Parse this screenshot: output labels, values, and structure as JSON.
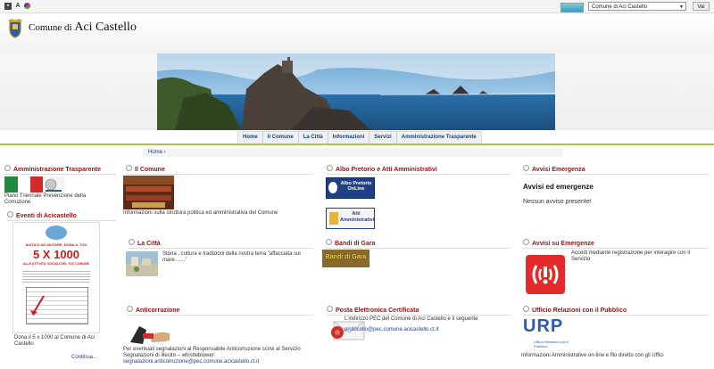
{
  "toolbar": {
    "select_value": "Comune di Aci Castello",
    "go_label": "Vai",
    "font_glyph": "A"
  },
  "site": {
    "prefix": "Comune di",
    "name": "Aci Castello"
  },
  "nav": {
    "items": [
      "Home",
      "Il Comune",
      "La Città",
      "Informazioni",
      "Servizi",
      "Amministrazione Trasparente"
    ]
  },
  "breadcrumb": "Home",
  "sections": {
    "amministrazione": {
      "title": "Amministrazione Trasparente",
      "text": "Piano Triennale Prevenzione della Corruzione"
    },
    "eventi": {
      "title": "Eventi di Acicastello",
      "poster_heading": "AIUTACI AD AIUTARE, DONA IL TUO",
      "poster_big": "5 X 1000",
      "poster_sub": "ALLE ATTIVITA' SOCIALI DEL TUO COMUNE",
      "text": "Dona il 5 x 1000 al Comune di Aci Castello",
      "more": "Continua..."
    },
    "comune": {
      "title": "Il Comune",
      "text": "Informazioni sulla struttura politica ed amministrativa del Comune"
    },
    "citta": {
      "title": "La Città",
      "text": "Storia , cultura e tradizioni della nostra terra \"affacciata sul mare.......\""
    },
    "anticorruzione": {
      "title": "Anticorruzione",
      "text": "Per eventuali segnalazioni al Responsabile Anticorruzione scrivi al Servizio Segnalazioni di illecito – whistleblower:",
      "email": "segnalazioni.anticorruzione@pec.comune.acicastello.ct.it"
    },
    "albo": {
      "title": "Albo Pretorio e Atti Amministrativi",
      "albo_label": "Albo Pretorio OnLine",
      "atti_label": "Atti Amministrativi"
    },
    "bandi": {
      "title": "Bandi di Gara",
      "img_label": "Bandi di Gara"
    },
    "pec": {
      "title": "Posta Elettronica Certificata",
      "text": "L'indirizzo PEC del Comune di Aci Castello è il seguente",
      "email": "protocollo@pec.comune.acicastello.ct.it"
    },
    "avvisi_emergenza": {
      "title": "Avvisi Emergenza",
      "heading": "Avvisi ed emergenze",
      "text": "Nessun avviso presente!"
    },
    "avvisi_su": {
      "title": "Avvisi su Emergenze",
      "text": "Accedi mediante registrazione per interagire con il Servizio"
    },
    "urp": {
      "title": "Ufficio Relazioni con il Pubblico",
      "logo_big": "URP",
      "logo_small": "Ufficio Relazioni con il Pubblico",
      "text": "Informazioni Amministrative on-line e filo diretto con gli Uffici"
    }
  },
  "colors": {
    "section_title": "#8a1616",
    "nav_text": "#1e3f7a",
    "accent_green": "#a3c644"
  }
}
